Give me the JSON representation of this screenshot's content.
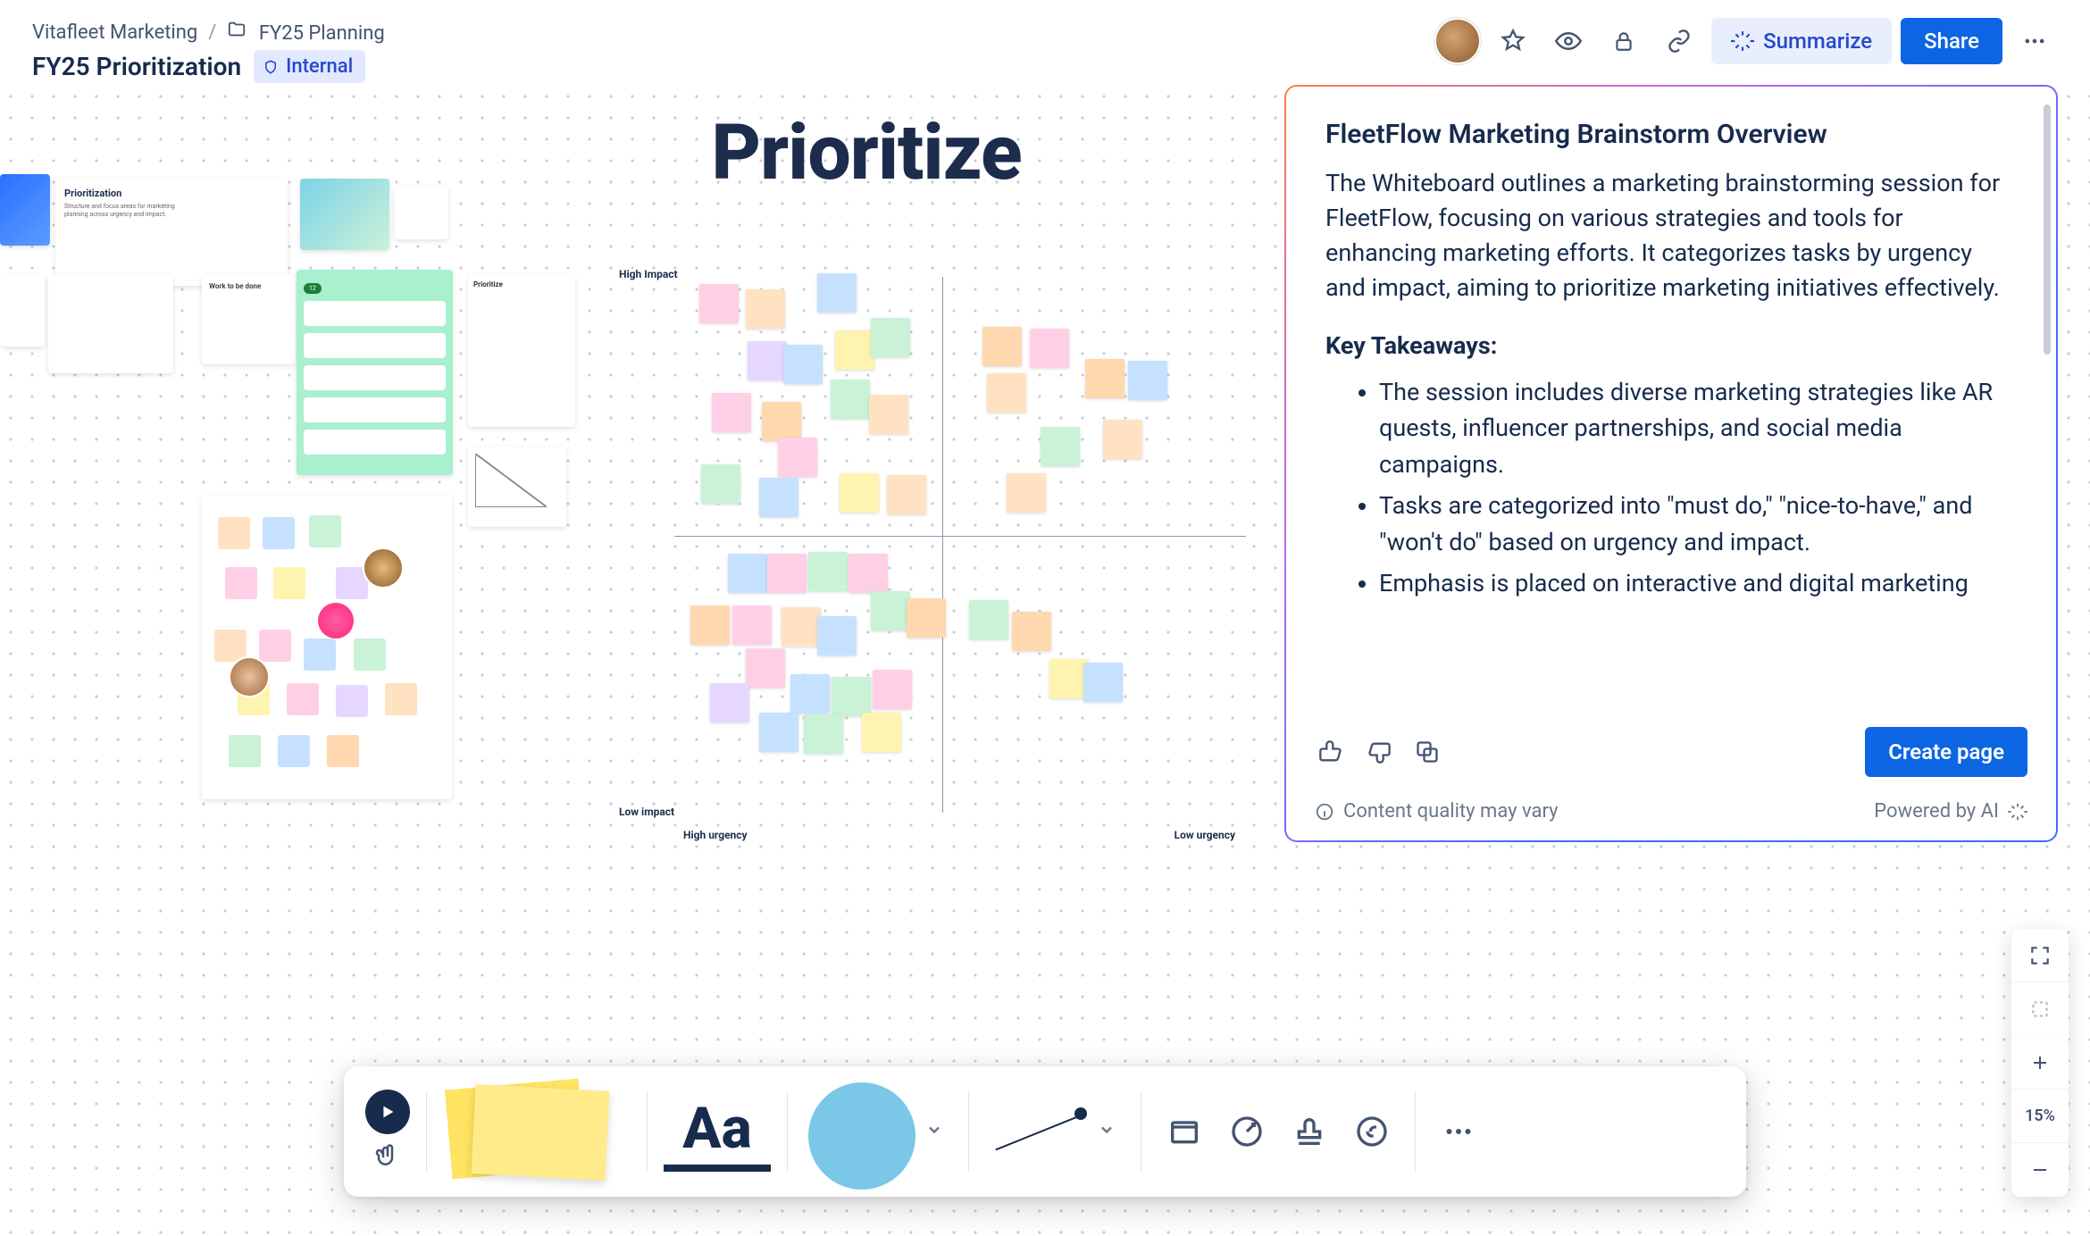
{
  "breadcrumb": {
    "space": "Vitafleet Marketing",
    "parent": "FY25 Planning"
  },
  "page_title": "FY25 Prioritization",
  "visibility_badge": "Internal",
  "canvas_heading": "Prioritize",
  "quad_labels": {
    "y_top": "High Impact",
    "y_bottom": "Low impact",
    "x_left": "High urgency",
    "x_right": "Low urgency"
  },
  "header_actions": {
    "summarize": "Summarize",
    "share": "Share"
  },
  "ai_panel": {
    "title": "FleetFlow Marketing Brainstorm Overview",
    "paragraph": "The Whiteboard outlines a marketing brainstorming session for FleetFlow, focusing on various strategies and tools for enhancing marketing efforts. It categorizes tasks by urgency and impact, aiming to prioritize marketing initiatives effectively.",
    "key_heading": "Key Takeaways:",
    "bullets": [
      "The session includes diverse marketing strategies like AR quests, influencer partnerships, and social media campaigns.",
      "Tasks are categorized into \"must do,\" \"nice-to-have,\" and \"won't do\" based on urgency and impact.",
      "Emphasis is placed on interactive and digital marketing"
    ],
    "create_page": "Create page",
    "quality_note": "Content quality may vary",
    "powered_by": "Powered by AI"
  },
  "mini_panels": {
    "b_title": "Prioritization",
    "g_work": "Work to be done",
    "i_title": "Prioritize"
  },
  "toolbar": {
    "text": "Aa"
  },
  "zoom": {
    "level": "15%"
  }
}
